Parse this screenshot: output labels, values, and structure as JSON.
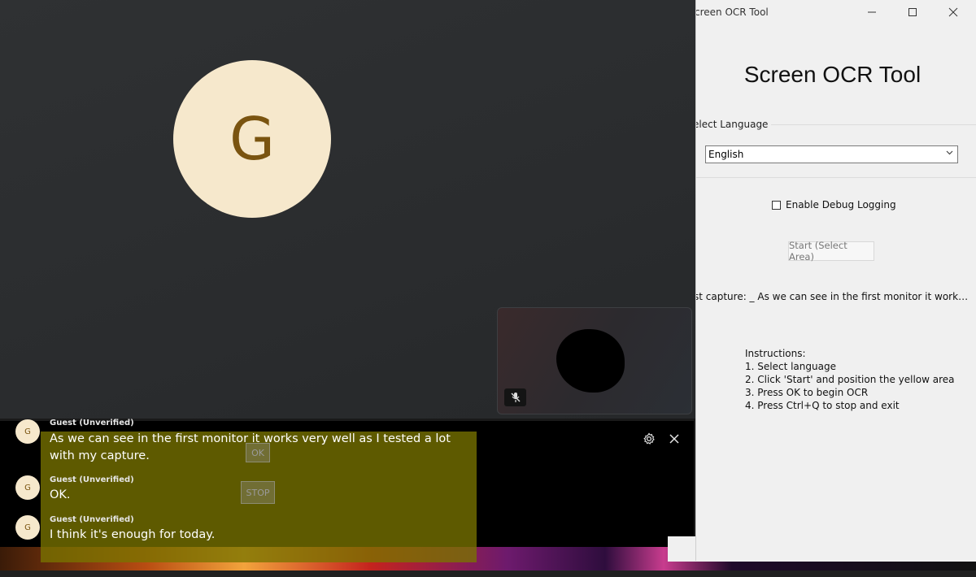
{
  "meeting": {
    "participant_initial": "G",
    "self_view": {
      "mic_icon": "mic-off-icon"
    },
    "captions": {
      "entries": [
        {
          "avatar": "G",
          "name": "Guest (Unverified)",
          "text": "As we can see in the first monitor it works very well as I tested a lot with my capture."
        },
        {
          "avatar": "G",
          "name": "Guest (Unverified)",
          "text": "OK."
        },
        {
          "avatar": "G",
          "name": "Guest (Unverified)",
          "text": "I think it's enough for today."
        }
      ],
      "overlay_buttons": {
        "ok": "OK",
        "stop": "STOP"
      },
      "settings_icon": "gear-icon",
      "close_icon": "close-icon"
    }
  },
  "ocr_tool": {
    "window_title": "creen OCR Tool",
    "heading": "Screen OCR Tool",
    "language_group_label": "elect Language",
    "language_selected": "English",
    "debug_label": "Enable Debug Logging",
    "debug_checked": false,
    "start_button": "Start (Select Area)",
    "last_capture": "st capture: _ As we can see in the first monitor it works very...",
    "instructions": {
      "title": "Instructions:",
      "steps": [
        "1. Select language",
        "2. Click 'Start' and position the yellow area",
        "3. Press OK to begin OCR",
        "4. Press Ctrl+Q to stop and exit"
      ]
    }
  }
}
